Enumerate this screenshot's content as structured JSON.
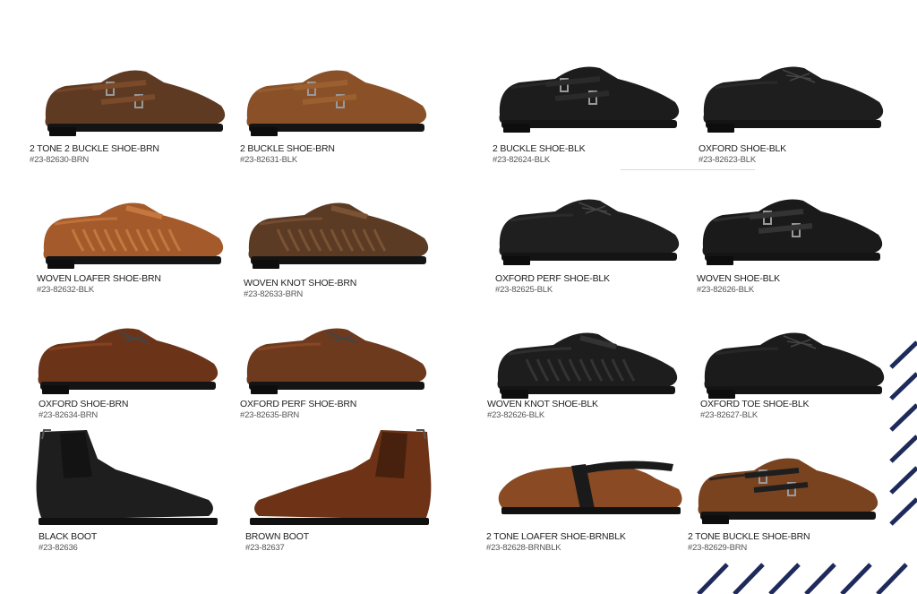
{
  "products": [
    {
      "name": "2 TONE 2 BUCKLE SHOE-BRN",
      "code": "#23-82630-BRN",
      "kind": "buckle",
      "color": "#5e3a22",
      "accent": "#7a4a2a"
    },
    {
      "name": "2 BUCKLE SHOE-BRN",
      "code": "#23-82631-BLK",
      "kind": "buckle",
      "color": "#8a5128",
      "accent": "#9b5f30"
    },
    {
      "name": "2 BUCKLE SHOE-BLK",
      "code": "#23-82624-BLK",
      "kind": "buckle",
      "color": "#1c1c1c",
      "accent": "#2a2a2a"
    },
    {
      "name": "OXFORD SHOE-BLK",
      "code": "#23-82623-BLK",
      "kind": "oxford",
      "color": "#1e1e1e",
      "accent": "#2c2c2c"
    },
    {
      "name": "WOVEN LOAFER SHOE-BRN",
      "code": "#23-82632-BLK",
      "kind": "woven",
      "color": "#a45a2a",
      "accent": "#c4773e"
    },
    {
      "name": "WOVEN KNOT SHOE-BRN",
      "code": "#23-82633-BRN",
      "kind": "woven",
      "color": "#5b3b24",
      "accent": "#7a5234"
    },
    {
      "name": "OXFORD PERF SHOE-BLK",
      "code": "#23-82625-BLK",
      "kind": "oxford",
      "color": "#1f1f1f",
      "accent": "#2e2e2e"
    },
    {
      "name": "WOVEN SHOE-BLK",
      "code": "#23-82626-BLK",
      "kind": "buckle",
      "color": "#1a1a1a",
      "accent": "#333333"
    },
    {
      "name": "OXFORD SHOE-BRN",
      "code": "#23-82634-BRN",
      "kind": "oxford",
      "color": "#6b3418",
      "accent": "#8a4522"
    },
    {
      "name": "OXFORD PERF SHOE-BRN",
      "code": "#23-82635-BRN",
      "kind": "oxford",
      "color": "#6e3a1e",
      "accent": "#8c4b28"
    },
    {
      "name": "WOVEN KNOT SHOE-BLK",
      "code": "#23-82626-BLK",
      "kind": "woven",
      "color": "#1d1d1d",
      "accent": "#333333"
    },
    {
      "name": "OXFORD TOE SHOE-BLK",
      "code": "#23-82627-BLK",
      "kind": "oxford",
      "color": "#1b1b1b",
      "accent": "#2b2b2b"
    },
    {
      "name": "BLACK BOOT",
      "code": "#23-82636",
      "kind": "boot",
      "color": "#1e1e1e",
      "accent": "#2b2b2b"
    },
    {
      "name": "BROWN BOOT",
      "code": "#23-82637",
      "kind": "boot",
      "color": "#6e3316",
      "accent": "#8a4220"
    },
    {
      "name": "2 TONE LOAFER SHOE-BRNBLK",
      "code": "#23-82628-BRNBLK",
      "kind": "loafer2",
      "color": "#8a4a24",
      "accent": "#1a1a1a"
    },
    {
      "name": "2 TONE BUCKLE SHOE-BRN",
      "code": "#23-82629-BRN",
      "kind": "buckle",
      "color": "#7a4320",
      "accent": "#1e1e1e"
    }
  ],
  "stripe_color": "#1e2a5a"
}
